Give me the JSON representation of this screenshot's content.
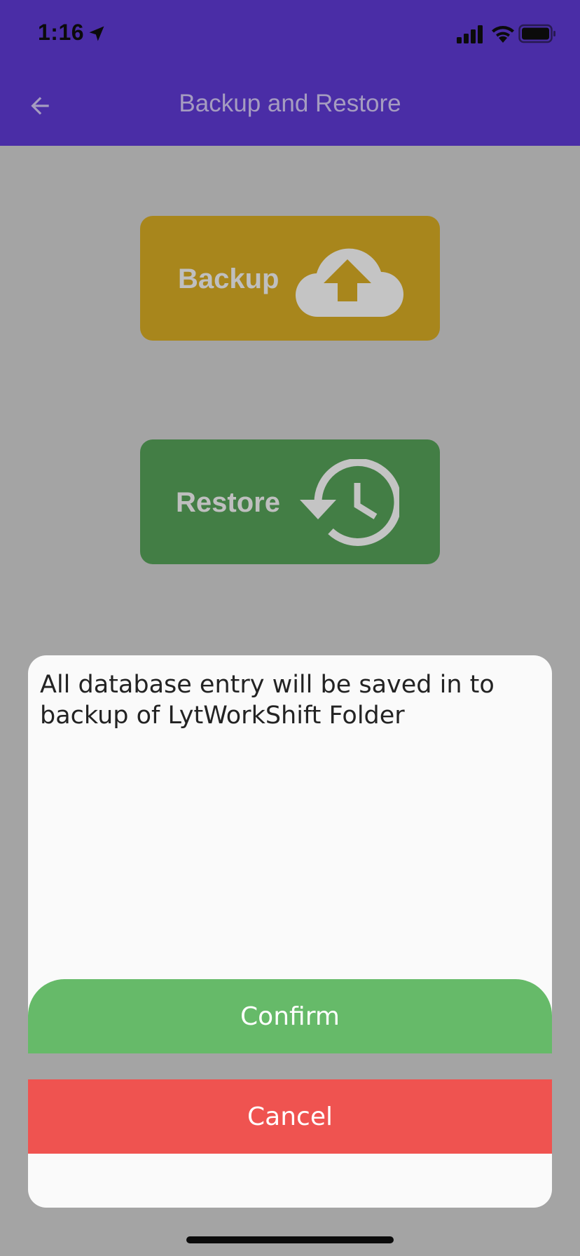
{
  "status_bar": {
    "time": "1:16",
    "icons": [
      "location-arrow-icon",
      "cellular-signal-icon",
      "wifi-icon",
      "battery-icon"
    ]
  },
  "app_bar": {
    "title": "Backup and Restore",
    "back_icon": "back-arrow-icon",
    "color": "#4a2da6"
  },
  "actions": {
    "backup": {
      "label": "Backup",
      "icon": "cloud-upload-icon",
      "color": "#a8861c"
    },
    "restore": {
      "label": "Restore",
      "icon": "history-restore-icon",
      "color": "#437e45"
    }
  },
  "dialog": {
    "message": "All database entry will be saved in to backup of LytWorkShift Folder",
    "confirm_label": "Confirm",
    "cancel_label": "Cancel",
    "confirm_color": "#66ba69",
    "cancel_color": "#ef5350"
  }
}
